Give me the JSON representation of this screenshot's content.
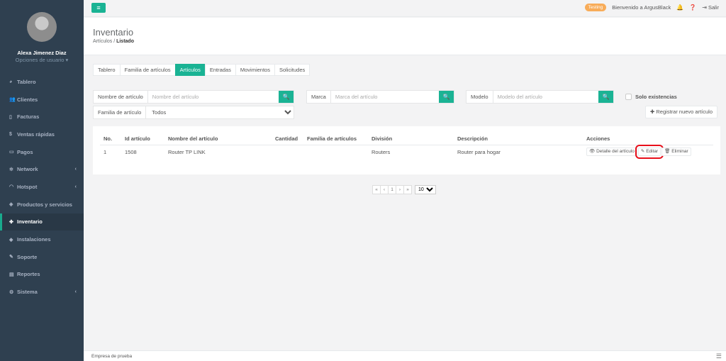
{
  "user": {
    "name": "Alexa Jimenez Diaz",
    "options": "Opciones de usuario ▾"
  },
  "sidebar": {
    "items": [
      {
        "label": "Tablero",
        "icon": "dashboard-icon"
      },
      {
        "label": "Clientes",
        "icon": "users-icon"
      },
      {
        "label": "Facturas",
        "icon": "file-icon"
      },
      {
        "label": "Ventas rápidas",
        "icon": "dollar-icon"
      },
      {
        "label": "Pagos",
        "icon": "money-icon"
      },
      {
        "label": "Network",
        "icon": "network-icon"
      },
      {
        "label": "Hotspot",
        "icon": "wifi-icon"
      },
      {
        "label": "Productos y servicios",
        "icon": "tag-icon"
      },
      {
        "label": "Inventario",
        "icon": "inventory-icon"
      },
      {
        "label": "Instalaciones",
        "icon": "wrench-icon"
      },
      {
        "label": "Soporte",
        "icon": "support-icon"
      },
      {
        "label": "Reportes",
        "icon": "book-icon"
      },
      {
        "label": "Sistema",
        "icon": "gears-icon"
      }
    ],
    "active": "Inventario"
  },
  "topbar": {
    "badge": "Testing",
    "welcome": "Bienvenido a ArgusBlack",
    "logout": "Salir"
  },
  "heading": {
    "title": "Inventario",
    "crumb_parent": "Artículos",
    "crumb_current": "Listado"
  },
  "tabs": [
    "Tablero",
    "Familia de artículos",
    "Artículos",
    "Entradas",
    "Movimientos",
    "Solicitudes"
  ],
  "filters": {
    "name_label": "Nombre de artículo",
    "name_placeholder": "Nombre del artículo",
    "brand_label": "Marca",
    "brand_placeholder": "Marca del artículo",
    "model_label": "Modelo",
    "model_placeholder": "Modelo del artículo",
    "family_label": "Familia de artículo",
    "family_value": "Todos",
    "solo_label": "Solo existencias",
    "register_button": "Registrar nuevo artículo"
  },
  "table": {
    "headers": [
      "No.",
      "Id artículo",
      "Nombre del artículo",
      "Cantidad",
      "Familia de artículos",
      "División",
      "Descripción",
      "Acciones"
    ],
    "rows": [
      {
        "no": "1",
        "id": "1508",
        "name": "Router TP LINK",
        "qty": "",
        "family": "",
        "division": "Routers",
        "desc": "Router para hogar"
      }
    ],
    "actions": {
      "detail": "Detalle del artículo",
      "edit": "Editar",
      "delete": "Eliminar"
    }
  },
  "pager": {
    "first": "«",
    "prev": "‹",
    "page": "1",
    "next": "›",
    "last": "»",
    "size": "10"
  },
  "footer": {
    "text": "Empresa de prueba"
  }
}
